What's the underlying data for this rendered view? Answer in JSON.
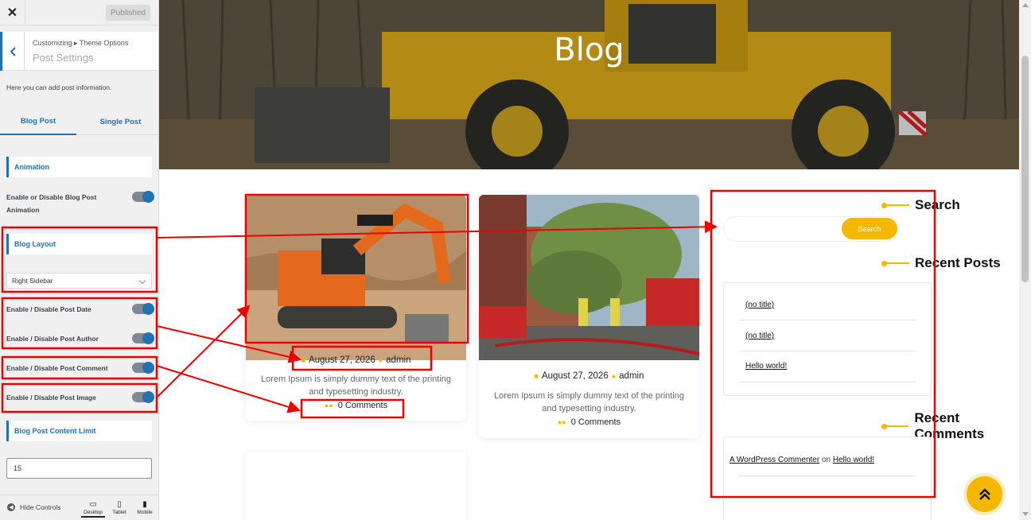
{
  "customizer": {
    "close_glyph": "✕",
    "publish_label": "Published",
    "breadcrumb": "Customizing ▸ Theme Options",
    "section_title": "Post Settings",
    "help_text": "Here you can add post information.",
    "tabs": [
      {
        "label": "Blog Post",
        "active": true
      },
      {
        "label": "Single Post",
        "active": false
      }
    ],
    "animation_heading": "Animation",
    "animation_label_line1": "Enable or Disable Blog Post",
    "animation_label_line2": "Animation",
    "layout_heading": "Blog Layout",
    "layout_value": "Right Sidebar",
    "toggles": {
      "post_date": "Enable / Disable Post Date",
      "post_author": "Enable / Disable Post Author",
      "post_comment": "Enable / Disable Post Comment",
      "post_image": "Enable / Disable Post Image"
    },
    "content_limit_heading": "Blog Post Content Limit",
    "content_limit_value": "15",
    "footer": {
      "hide_controls": "Hide Controls",
      "devices": [
        "Desktop",
        "Tablet",
        "Mobile"
      ]
    }
  },
  "preview": {
    "hero_title": "Blog",
    "posts": [
      {
        "date": "August 27, 2026",
        "author": "admin",
        "excerpt": "Lorem Ipsum is simply dummy text of the printing and typesetting industry.",
        "comments": "0 Comments",
        "image": "orange-excavator"
      },
      {
        "date": "August 27, 2026",
        "author": "admin",
        "excerpt": "Lorem Ipsum is simply dummy text of the printing and typesetting industry.",
        "comments": "0 Comments",
        "image": "fire-trucks-street"
      }
    ],
    "sidebar": {
      "search_title": "Search",
      "search_button": "Search",
      "recent_posts_title": "Recent Posts",
      "recent_posts": [
        "(no title)",
        "(no title)",
        "Hello world!"
      ],
      "recent_comments_title": "Recent Comments",
      "recent_comment": {
        "author": "A WordPress Commenter",
        "on": "on",
        "post": "Hello world!"
      }
    }
  },
  "colors": {
    "wp_blue": "#2271b1",
    "accent_yellow": "#f5b800",
    "annotation_red": "#ee0000"
  }
}
